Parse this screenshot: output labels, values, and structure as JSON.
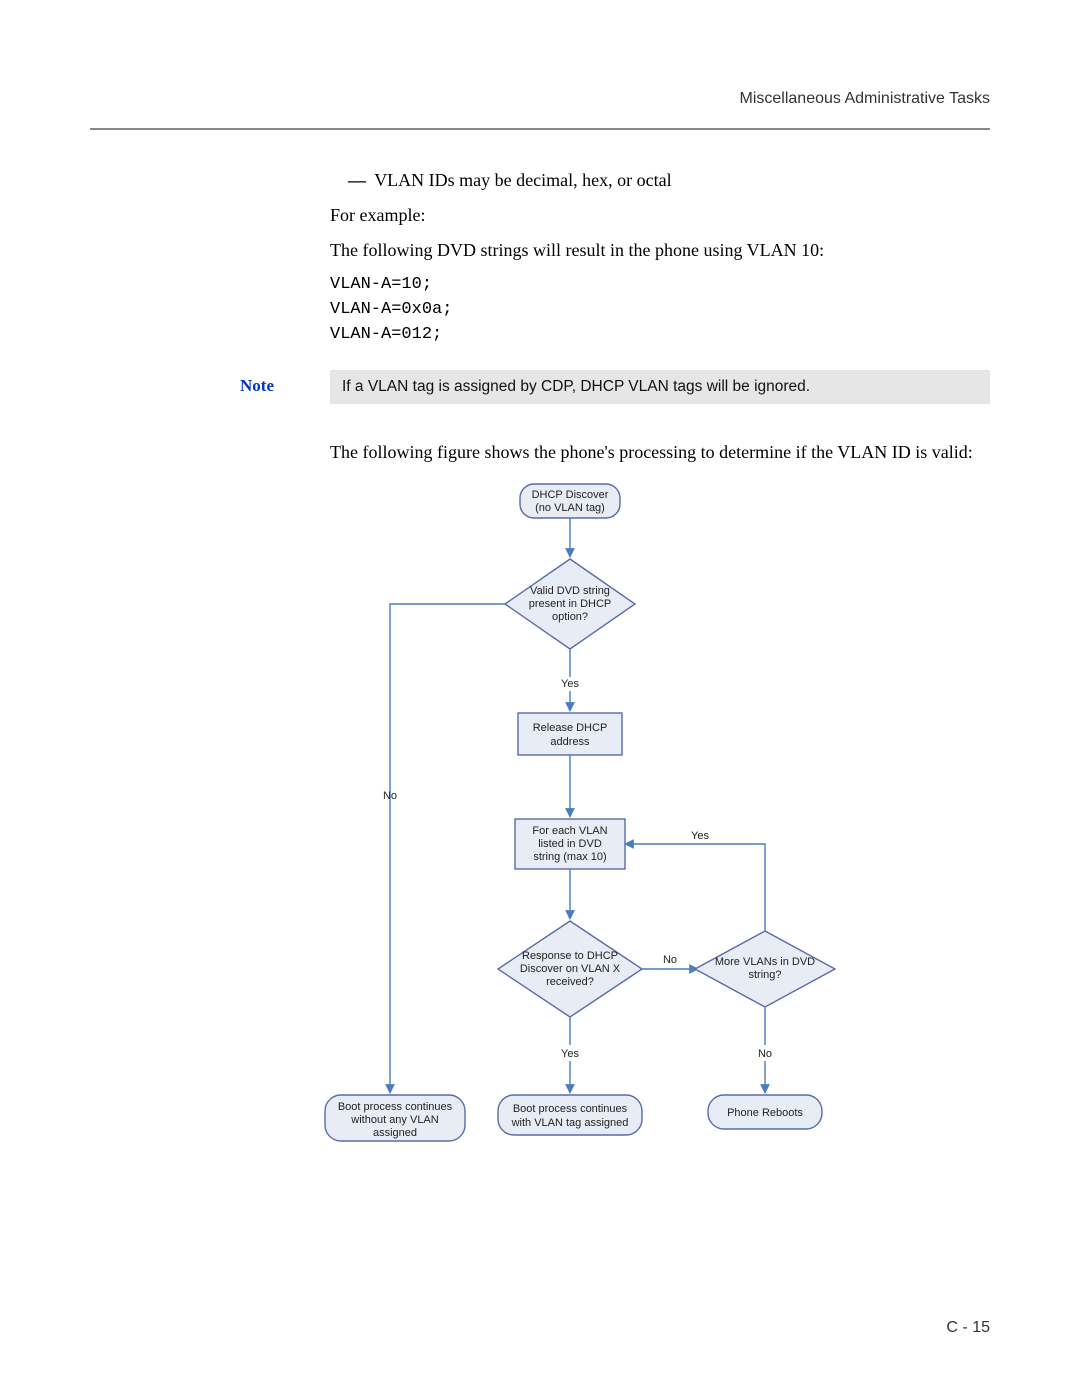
{
  "header": {
    "title": "Miscellaneous Administrative Tasks"
  },
  "content": {
    "bullet1": "VLAN IDs may be decimal, hex, or octal",
    "for_example": "For example:",
    "intro_dvd": "The following DVD strings will result in the phone using VLAN 10:",
    "code1": "VLAN-A=10;",
    "code2": "VLAN-A=0x0a;",
    "code3": "VLAN-A=012;",
    "figure_intro": "The following figure shows the phone's processing to determine if the VLAN ID is valid:"
  },
  "note": {
    "label": "Note",
    "text": "If a VLAN tag is assigned by CDP, DHCP VLAN tags will be ignored."
  },
  "flowchart": {
    "start1": "DHCP Discover",
    "start2": "(no VLAN tag)",
    "d1a": "Valid DVD string",
    "d1b": "present in DHCP",
    "d1c": "option?",
    "r1a": "Release DHCP",
    "r1b": "address",
    "r2a": "For each VLAN",
    "r2b": "listed in DVD",
    "r2c": "string (max 10)",
    "d2a": "Response to DHCP",
    "d2b": "Discover on VLAN X",
    "d2c": "received?",
    "d3a": "More VLANs in DVD",
    "d3b": "string?",
    "t1a": "Boot process continues",
    "t1b": "without any VLAN",
    "t1c": "assigned",
    "t2a": "Boot process continues",
    "t2b": "with VLAN tag assigned",
    "t3": "Phone Reboots",
    "yes": "Yes",
    "no": "No"
  },
  "pagenum": "C - 15"
}
